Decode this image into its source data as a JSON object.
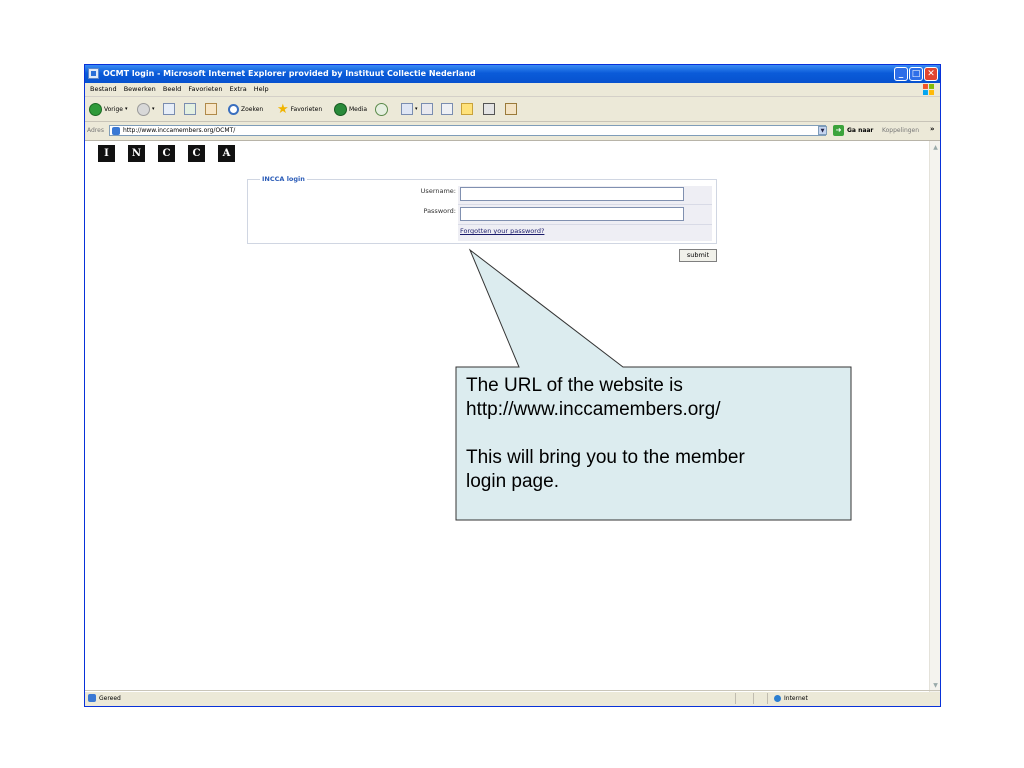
{
  "window": {
    "title": "OCMT login - Microsoft Internet Explorer provided by Instituut Collectie Nederland",
    "minimize_glyph": "_",
    "maximize_glyph": "□",
    "close_glyph": "✕"
  },
  "menubar": {
    "items": [
      "Bestand",
      "Bewerken",
      "Beeld",
      "Favorieten",
      "Extra",
      "Help"
    ]
  },
  "toolbar": {
    "back_label": "Vorige",
    "search_label": "Zoeken",
    "favorites_label": "Favorieten",
    "media_label": "Media"
  },
  "addressbar": {
    "label": "Adres",
    "url": "http://www.inccamembers.org/OCMT/",
    "go_label": "Ga naar",
    "links_label": "Koppelingen",
    "chevron": "»"
  },
  "page": {
    "logo_letters": [
      "I",
      "N",
      "C",
      "C",
      "A"
    ],
    "login_legend": "INCCA login",
    "username_label": "Username:",
    "password_label": "Password:",
    "forgot_link": "Forgotten your password?",
    "submit_label": "submit"
  },
  "statusbar": {
    "text": "Gereed",
    "zone": "Internet"
  },
  "callout": {
    "line1": "The URL of the website is",
    "line2": "http://www.inccamembers.org/",
    "line3": "This will bring you to the member",
    "line4": "login page."
  },
  "colors": {
    "titlebar": "#0a5bd9",
    "callout_fill": "#dcecef",
    "link": "#1a1a6a",
    "legend": "#2b5cb8"
  }
}
